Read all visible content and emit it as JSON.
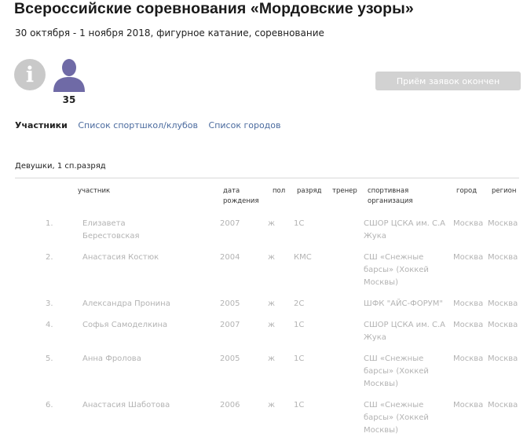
{
  "header": {
    "title": "Всероссийские соревнования «Мордовские узоры»",
    "subtitle": "30 октября - 1 ноября 2018, фигурное катание, соревнование"
  },
  "stats": {
    "participants_count": "35",
    "info_icon": "info-icon",
    "user_icon": "user-icon"
  },
  "registration": {
    "button_label": "Приём заявок окончен"
  },
  "tabs": [
    {
      "label": "Участники"
    },
    {
      "label": "Список спортшкол/клубов"
    },
    {
      "label": "Список городов"
    }
  ],
  "group": {
    "title": "Девушки, 1 сп.разряд"
  },
  "table": {
    "headers": {
      "participant": "участник",
      "birth_date_l1": "дата",
      "birth_date_l2": "рождения",
      "sex": "пол",
      "rank": "разряд",
      "coach": "тренер",
      "org_l1": "спортивная",
      "org_l2": "организация",
      "city": "город",
      "region": "регион"
    },
    "rows": [
      {
        "num": "1.",
        "name_l1": "Елизавета",
        "name_l2": "Берестовская",
        "year": "2007",
        "sex": "ж",
        "rank": "1С",
        "org_l1": "СШОР ЦСКА им. С.А",
        "org_l2": "Жука",
        "org_l3": "",
        "city": "Москва",
        "region": "Москва"
      },
      {
        "num": "2.",
        "name_l1": "Анастасия Костюк",
        "name_l2": "",
        "year": "2004",
        "sex": "ж",
        "rank": "КМС",
        "org_l1": "СШ «Снежные",
        "org_l2": "барсы» (Хоккей",
        "org_l3": "Москвы)",
        "city": "Москва",
        "region": "Москва"
      },
      {
        "num": "3.",
        "name_l1": "Александра Пронина",
        "name_l2": "",
        "year": "2005",
        "sex": "ж",
        "rank": "2С",
        "org_l1": "ШФК \"АЙС-ФОРУМ\"",
        "org_l2": "",
        "org_l3": "",
        "city": "Москва",
        "region": "Москва"
      },
      {
        "num": "4.",
        "name_l1": "Софья Самоделкина",
        "name_l2": "",
        "year": "2007",
        "sex": "ж",
        "rank": "1С",
        "org_l1": "СШОР ЦСКА им. С.А",
        "org_l2": "Жука",
        "org_l3": "",
        "city": "Москва",
        "region": "Москва"
      },
      {
        "num": "5.",
        "name_l1": "Анна Фролова",
        "name_l2": "",
        "year": "2005",
        "sex": "ж",
        "rank": "1С",
        "org_l1": "СШ «Снежные",
        "org_l2": "барсы» (Хоккей",
        "org_l3": "Москвы)",
        "city": "Москва",
        "region": "Москва"
      },
      {
        "num": "6.",
        "name_l1": "Анастасия Шаботова",
        "name_l2": "",
        "year": "2006",
        "sex": "ж",
        "rank": "1С",
        "org_l1": "СШ «Снежные",
        "org_l2": "барсы» (Хоккей",
        "org_l3": "Москвы)",
        "city": "Москва",
        "region": "Москва"
      }
    ]
  }
}
